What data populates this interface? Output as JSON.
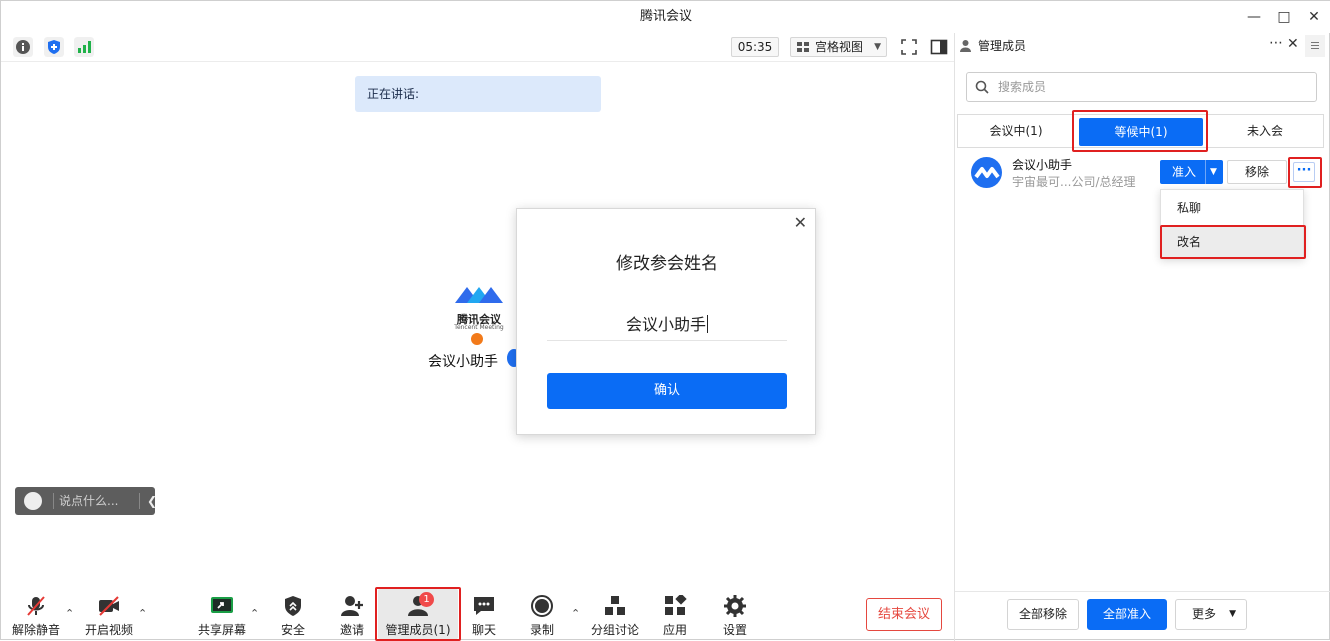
{
  "window": {
    "title": "腾讯会议"
  },
  "toolbar_top": {
    "timer": "05:35",
    "view_mode": "宫格视图"
  },
  "stage": {
    "speaking_label": "正在讲话:",
    "participant_name": "会议小助手",
    "logo_cn": "腾讯会议",
    "logo_en": "Tencent Meeting",
    "chat_placeholder": "说点什么..."
  },
  "rename_dialog": {
    "title": "修改参会姓名",
    "value": "会议小助手",
    "confirm_label": "确认"
  },
  "bottom_toolbar": {
    "items": [
      {
        "label": "解除静音",
        "icon": "mic-muted-icon"
      },
      {
        "label": "开启视频",
        "icon": "video-off-icon"
      },
      {
        "label": "共享屏幕",
        "icon": "share-screen-icon"
      },
      {
        "label": "安全",
        "icon": "shield-icon"
      },
      {
        "label": "邀请",
        "icon": "invite-user-icon"
      },
      {
        "label": "管理成员(1)",
        "icon": "members-icon"
      },
      {
        "label": "聊天",
        "icon": "chat-icon"
      },
      {
        "label": "录制",
        "icon": "record-icon"
      },
      {
        "label": "分组讨论",
        "icon": "breakout-icon"
      },
      {
        "label": "应用",
        "icon": "apps-icon"
      },
      {
        "label": "设置",
        "icon": "gear-icon"
      }
    ],
    "members_badge": "1",
    "end_label": "结束会议"
  },
  "panel": {
    "title": "管理成员",
    "search_placeholder": "搜索成员",
    "tabs": [
      "会议中(1)",
      "等候中(1)",
      "未入会"
    ],
    "active_tab": 1,
    "member": {
      "name": "会议小助手",
      "desc": "宇宙最可...公司/总经理",
      "admit_label": "准入",
      "remove_label": "移除",
      "more_label": "···"
    },
    "dropdown": [
      "私聊",
      "改名"
    ],
    "footer": {
      "remove_all": "全部移除",
      "admit_all": "全部准入",
      "more": "更多"
    }
  },
  "colors": {
    "primary": "#0a6cf5",
    "highlight": "#e02020",
    "danger": "#e5483f"
  }
}
